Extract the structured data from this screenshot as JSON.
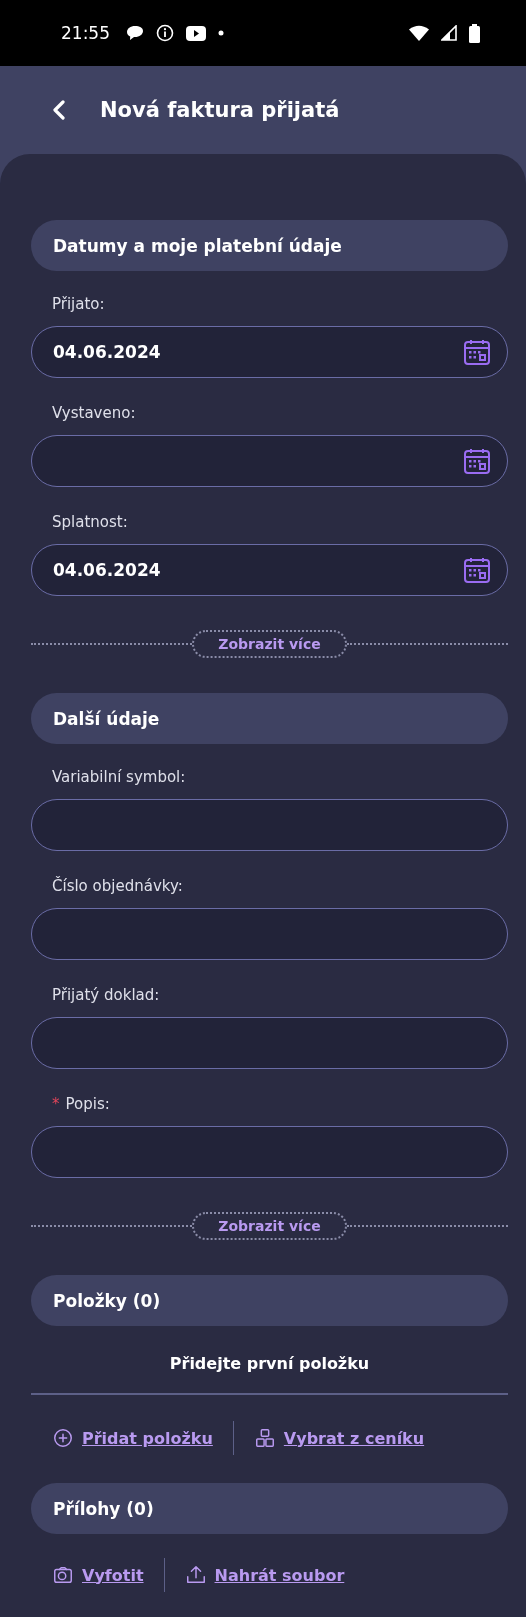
{
  "status_bar": {
    "time": "21:55"
  },
  "header": {
    "title": "Nová faktura přijatá"
  },
  "sections": [
    {
      "kind": "fields",
      "title": "Datumy a moje platební údaje",
      "fields": [
        {
          "label": "Přijato:",
          "value": "04.06.2024",
          "kind": "date"
        },
        {
          "label": "Vystaveno:",
          "kind": "date"
        },
        {
          "label": "Splatnost:",
          "value": "04.06.2024",
          "kind": "date"
        }
      ],
      "more": "Zobrazit více"
    },
    {
      "kind": "fields",
      "title": "Další údaje",
      "fields": [
        {
          "label": "Variabilní symbol:",
          "kind": "text"
        },
        {
          "label": "Číslo objednávky:",
          "kind": "text"
        },
        {
          "label": "Přijatý doklad:",
          "kind": "text"
        },
        {
          "label": "Popis:",
          "kind": "text",
          "required_mark": "*"
        }
      ],
      "more": "Zobrazit více"
    },
    {
      "kind": "items",
      "title": "Položky (0)",
      "empty": "Přidejte první položku",
      "actions": [
        {
          "label": "Přidat položku",
          "kind": "plus"
        },
        {
          "label": "Vybrat z ceníku",
          "kind": "boxes"
        }
      ]
    },
    {
      "kind": "attachments",
      "title": "Přílohy (0)",
      "actions": [
        {
          "label": "Vyfotit",
          "kind": "camera"
        },
        {
          "label": "Nahrát soubor",
          "kind": "upload"
        }
      ]
    }
  ]
}
